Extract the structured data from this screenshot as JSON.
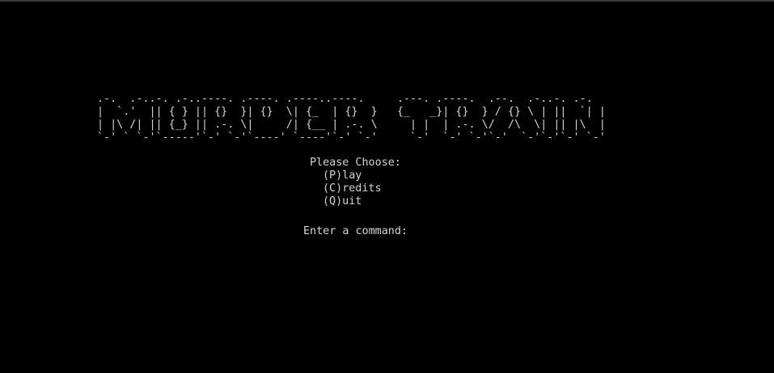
{
  "colors": {
    "background": "#000000",
    "foreground": "#d4d4d4"
  },
  "banner": {
    "lines": [
      ".-.  .-..-. .-..----. .----. .----..----.     .---. .----.  .--.  .-..-. .-.",
      "|  `.'  || { } || {}  }| {}  \\| {_  | {}  }   {_   _}| {}  } / {} \\ | ||  `| |",
      "| |\\ /| || {_} || .-. \\|     /| {__ | .-. \\     | |  | .-. \\/  /\\  \\| || |\\  |",
      "`-' ` `-'`-----'`-' `-'`----' `----'`-' `-'     `-'  `-' `-'`-'  `-'`-'`-' `-'"
    ]
  },
  "menu": {
    "heading": "Please Choose:",
    "options": [
      "(P)lay",
      "(C)redits",
      "(Q)uit"
    ],
    "prompt": "Enter a command:",
    "input_value": ""
  }
}
